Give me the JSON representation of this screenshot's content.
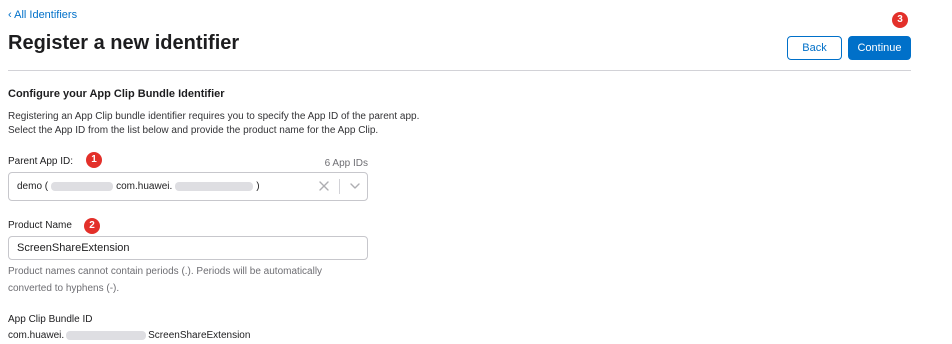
{
  "nav": {
    "back_link": "‹ All Identifiers"
  },
  "header": {
    "title": "Register a new identifier"
  },
  "actions": {
    "back_label": "Back",
    "continue_label": "Continue"
  },
  "badges": {
    "parent": "1",
    "product": "2",
    "continue": "3"
  },
  "section": {
    "title": "Configure your App Clip Bundle Identifier",
    "description_line1": "Registering an App Clip bundle identifier requires you to specify the App ID of the parent app.",
    "description_line2": "Select the App ID from the list below and provide the product name for the App Clip."
  },
  "parent_app_id": {
    "label": "Parent App ID:",
    "count": "6 App IDs",
    "selected_prefix": "demo (",
    "selected_middle": "com.huawei.",
    "selected_suffix": ")",
    "clear_icon": "close-icon",
    "dropdown_icon": "chevron-down-icon"
  },
  "product_name": {
    "label": "Product Name",
    "value": "ScreenShareExtension",
    "help_line1": "Product names cannot contain periods (.). Periods will be automatically",
    "help_line2": "converted to hyphens (-)."
  },
  "app_clip_bundle_id": {
    "label": "App Clip Bundle ID",
    "value_prefix": "com.huawei.",
    "value_suffix": "ScreenShareExtension"
  },
  "colors": {
    "accent": "#0070c9",
    "badge": "#e3302a",
    "text": "#1d1d1f",
    "muted": "#6e6e73",
    "divider": "#d2d2d7"
  }
}
